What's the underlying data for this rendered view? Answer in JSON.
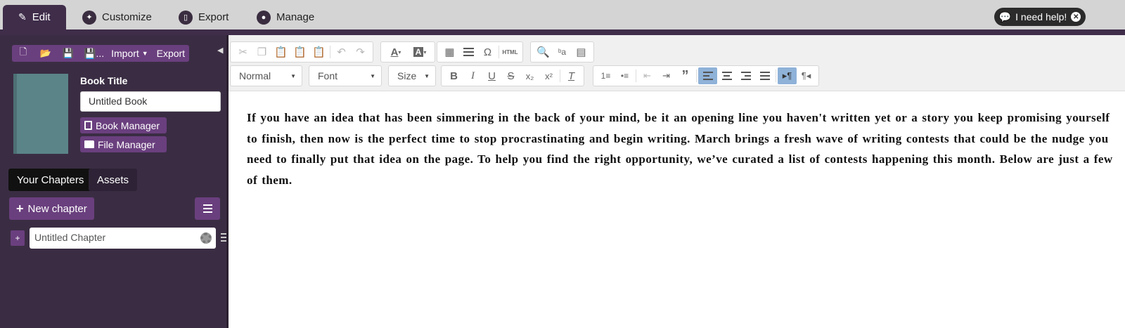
{
  "nav": {
    "tabs": [
      {
        "label": "Edit",
        "icon": "pencil-icon"
      },
      {
        "label": "Customize",
        "icon": "wrench-icon"
      },
      {
        "label": "Export",
        "icon": "tablet-icon"
      },
      {
        "label": "Manage",
        "icon": "user-icon"
      }
    ],
    "help_label": "I need help!"
  },
  "sidebar": {
    "toolbar": {
      "import_label": "Import",
      "export_label": "Export",
      "saveas_suffix": "..."
    },
    "book_title_label": "Book Title",
    "book_title_value": "Untitled Book",
    "book_manager_label": "Book Manager",
    "file_manager_label": "File Manager",
    "tabs": {
      "chapters": "Your Chapters",
      "assets": "Assets"
    },
    "new_chapter_label": "New chapter",
    "chapter_plus": "+",
    "chapters": [
      {
        "title": "Untitled Chapter"
      }
    ]
  },
  "editor": {
    "format_select": "Normal",
    "font_select": "Font",
    "size_select": "Size",
    "content": "If you have an idea that has been simmering in the back of your mind, be it an opening line you haven't written yet or a story you keep promising yourself to finish, then now is the perfect time to stop procrastinating and begin writing. March brings a fresh wave of writing contests that could be the nudge you need to finally put that idea on the page. To help you find the right opportunity, we’ve curated a list of contests happening this month. Below are just a few of them."
  },
  "colors": {
    "sidebar_bg": "#3a2d43",
    "accent_purple": "#6a3f7e",
    "topbar_bg": "#d4d4d4",
    "active_toolbar_button": "#8fb2d8"
  }
}
